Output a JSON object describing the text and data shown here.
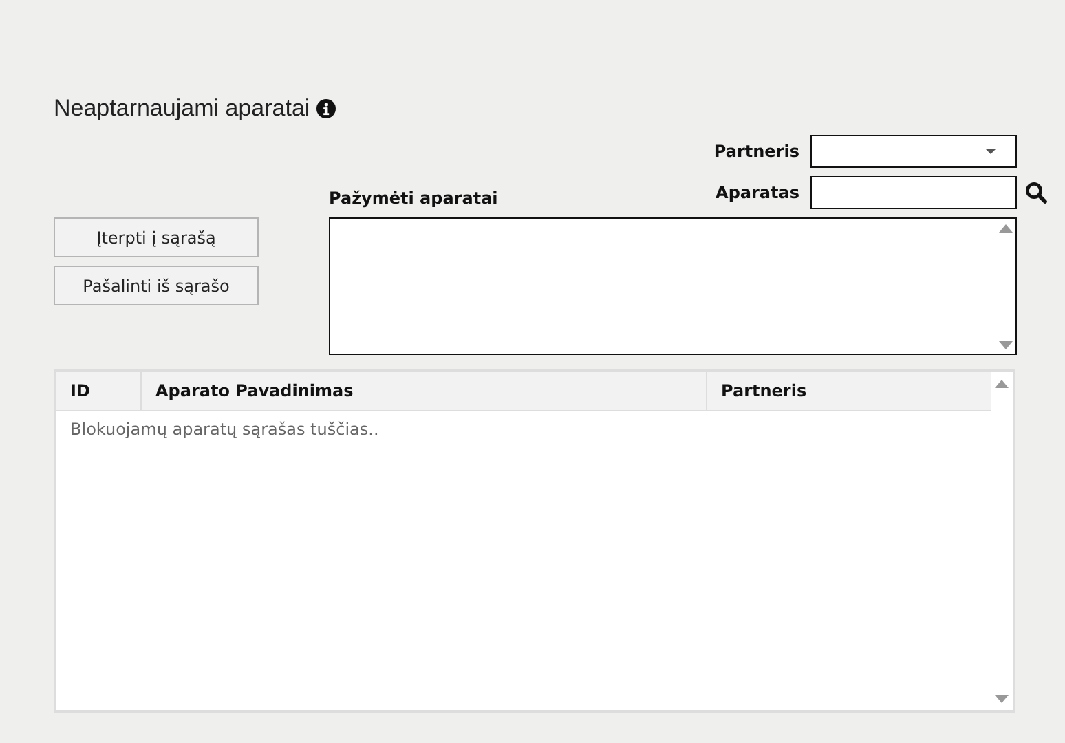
{
  "page_title": "Neaptarnaujami aparatai",
  "filters": [
    {
      "kind": "dropdown",
      "label": "Partneris"
    },
    {
      "kind": "search",
      "label": "Aparatas"
    }
  ],
  "selected_list": {
    "label": "Pažymėti aparatai"
  },
  "buttons": [
    "Įterpti į sąrašą",
    "Pašalinti iš sąrašo"
  ],
  "table": {
    "columns": [
      "ID",
      "Aparato Pavadinimas",
      "Partneris"
    ],
    "empty_message": "Blokuojamų aparatų sąrašas tuščias.."
  }
}
